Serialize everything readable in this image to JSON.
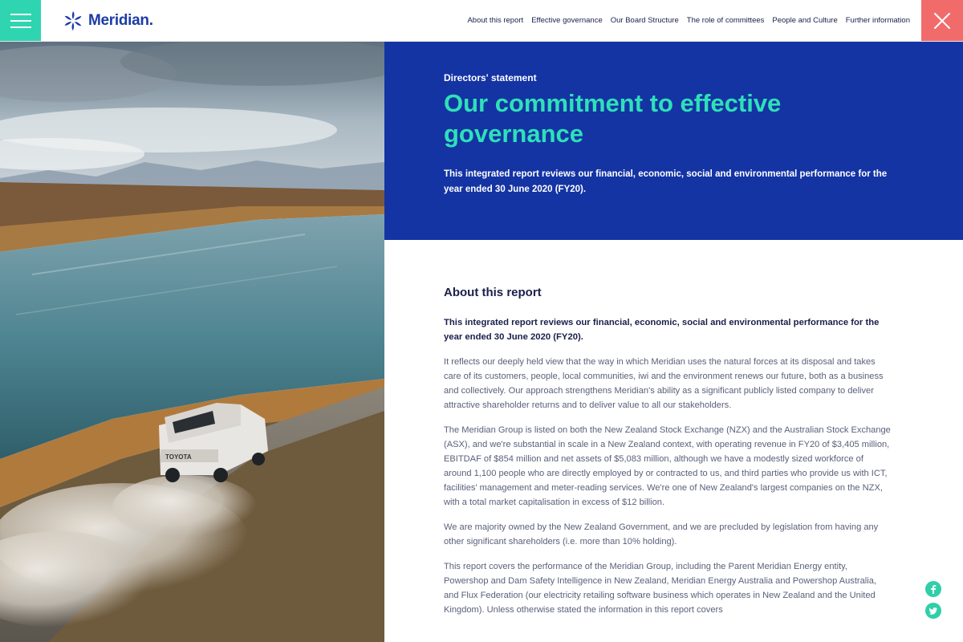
{
  "header": {
    "logo_text": "Meridian.",
    "nav": [
      "About this report",
      "Effective governance",
      "Our Board Structure",
      "The role of committees",
      "People and Culture",
      "Further information"
    ]
  },
  "photo": {
    "vehicle_text": "TOYOTA"
  },
  "hero": {
    "eyebrow": "Directors' statement",
    "title": "Our commitment to effective governance",
    "lead": "This integrated report reviews our financial, economic, social and environmental performance for the year ended 30 June 2020 (FY20)."
  },
  "content": {
    "section_title": "About this report",
    "lead": "This integrated report reviews our financial, economic, social and environmental performance for the year ended 30 June 2020 (FY20).",
    "paragraphs": [
      "It reflects our deeply held view that the way in which Meridian uses the natural forces at its disposal and takes care of its customers, people, local communities, iwi and the environment renews our future, both as a business and collectively. Our approach strengthens Meridian's ability as a significant publicly listed company to deliver attractive shareholder returns and to deliver value to all our stakeholders.",
      "The Meridian Group is listed on both the New Zealand Stock Exchange (NZX) and the Australian Stock Exchange (ASX), and we're substantial in scale in a New Zealand context, with operating revenue in FY20 of $3,405 million, EBITDAF of $854 million and net assets of $5,083 million, although we have a modestly sized workforce of around 1,100 people who are directly employed by or contracted to us, and third parties who provide us with ICT, facilities' management and meter-reading services. We're one of New Zealand's largest companies on the NZX, with a total market capitalisation in excess of $12 billion.",
      "We are majority owned by the New Zealand Government, and we are precluded by legislation from having any other significant shareholders (i.e. more than 10% holding).",
      "This report covers the performance of the Meridian Group, including the Parent Meridian Energy entity, Powershop and Dam Safety Intelligence in New Zealand, Meridian Energy Australia and Powershop Australia, and Flux Federation (our electricity retailing software business which operates in New Zealand and the United Kingdom). Unless otherwise stated the information in this report covers"
    ]
  },
  "colors": {
    "brand_blue": "#1434a4",
    "accent_teal": "#2fe0b8",
    "menu_teal": "#2fd4b0",
    "close_red": "#f26b6b",
    "logo_blue": "#1c3ba6"
  },
  "icons": {
    "menu": "hamburger-icon",
    "close": "close-icon",
    "logo": "meridian-logo-icon",
    "facebook": "facebook-icon",
    "twitter": "twitter-icon"
  }
}
